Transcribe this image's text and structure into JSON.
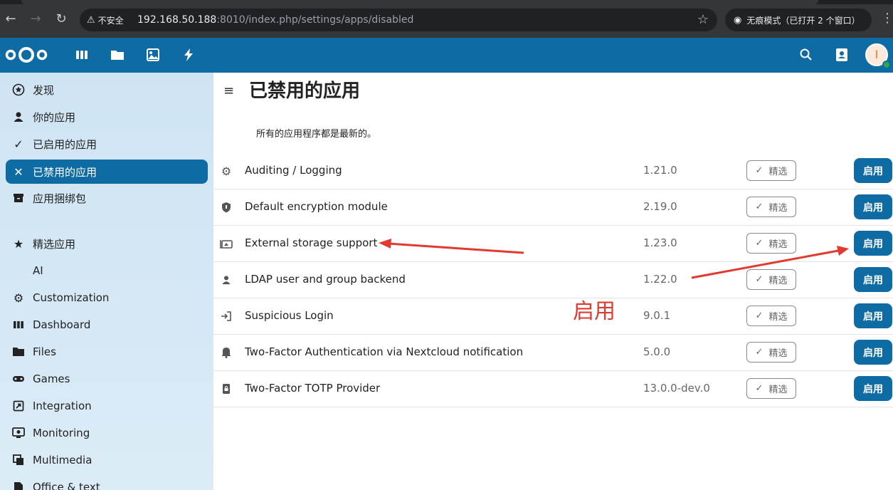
{
  "browser": {
    "security_label": "不安全",
    "url_host": "192.168.50.188",
    "url_path": ":8010/index.php/settings/apps/disabled",
    "incognito_label": "无痕模式（已打开 2 个窗口）",
    "icons": [
      "back-icon",
      "forward-icon",
      "reload-icon",
      "warning-icon",
      "star-icon",
      "incognito-icon",
      "menu-icon"
    ]
  },
  "header": {
    "icons": [
      "dashboard-icon",
      "files-icon",
      "photos-icon",
      "activity-icon",
      "search-icon",
      "contacts-icon"
    ],
    "avatar_initial": "I",
    "colors": {
      "brand": "#0f6ba3",
      "status_online": "#2ca84a"
    }
  },
  "sidebar": {
    "items": [
      {
        "label": "发现",
        "icon": "star-circle-icon"
      },
      {
        "label": "你的应用",
        "icon": "user-icon"
      },
      {
        "label": "已启用的应用",
        "icon": "check-icon"
      },
      {
        "label": "已禁用的应用",
        "icon": "close-icon",
        "active": true
      },
      {
        "label": "应用捆绑包",
        "icon": "archive-icon"
      },
      {
        "label": "精选应用",
        "icon": "star-icon"
      },
      {
        "label": "AI",
        "icon": ""
      },
      {
        "label": "Customization",
        "icon": "gear-icon"
      },
      {
        "label": "Dashboard",
        "icon": "dashboard-icon"
      },
      {
        "label": "Files",
        "icon": "folder-icon"
      },
      {
        "label": "Games",
        "icon": "gamepad-icon"
      },
      {
        "label": "Integration",
        "icon": "integration-icon"
      },
      {
        "label": "Monitoring",
        "icon": "monitor-icon"
      },
      {
        "label": "Multimedia",
        "icon": "multimedia-icon"
      },
      {
        "label": "Office & text",
        "icon": "document-icon"
      }
    ]
  },
  "main": {
    "title": "已禁用的应用",
    "subtitle": "所有的应用程序都是最新的。",
    "featured_label": "精选",
    "enable_label": "启用",
    "apps": [
      {
        "name": "Auditing / Logging",
        "version": "1.21.0",
        "icon": "gear-icon"
      },
      {
        "name": "Default encryption module",
        "version": "2.19.0",
        "icon": "shield-icon"
      },
      {
        "name": "External storage support",
        "version": "1.23.0",
        "icon": "external-storage-icon"
      },
      {
        "name": "LDAP user and group backend",
        "version": "1.22.0",
        "icon": "user-icon"
      },
      {
        "name": "Suspicious Login",
        "version": "9.0.1",
        "icon": "login-icon"
      },
      {
        "name": "Two-Factor Authentication via Nextcloud notification",
        "version": "5.0.0",
        "icon": "notification-bell-icon"
      },
      {
        "name": "Two-Factor TOTP Provider",
        "version": "13.0.0-dev.0",
        "icon": "phone-lock-icon"
      }
    ]
  },
  "annotation": {
    "text": "启用",
    "color": "#e23a2e"
  }
}
